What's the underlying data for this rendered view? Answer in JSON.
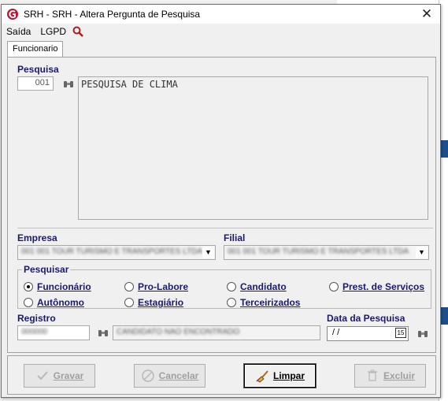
{
  "window": {
    "title": "SRH -  SRH - Altera Pergunta de Pesquisa",
    "close": "✕"
  },
  "menu": {
    "items": [
      "Saída",
      "LGPD"
    ]
  },
  "tabs": [
    {
      "label": "Funcionario"
    }
  ],
  "form": {
    "pesquisa_label": "Pesquisa",
    "pesquisa_code": "001",
    "pesquisa_text": "PESQUISA DE CLIMA",
    "empresa_label": "Empresa",
    "empresa_value": "001 001 TOUR TURISMO E TRANSPORTES LTDA",
    "filial_label": "Filial",
    "filial_value": "001 001 TOUR TURISMO E TRANSPORTES LTDA",
    "pesquisar_label": "Pesquisar",
    "radios": [
      {
        "label": "Funcionário",
        "checked": true
      },
      {
        "label": "Pro-Labore",
        "checked": false
      },
      {
        "label": "Candidato",
        "checked": false
      },
      {
        "label": "Prest. de Serviços",
        "checked": false
      },
      {
        "label": "Autônomo",
        "checked": false
      },
      {
        "label": "Estagiário",
        "checked": false
      },
      {
        "label": "Terceirizados",
        "checked": false
      }
    ],
    "registro_label": "Registro",
    "registro_value": "000000",
    "registro_name": "CANDIDATO NAO ENCONTRADO",
    "data_label": "Data da Pesquisa",
    "data_value": "/  /",
    "cal_day": "15"
  },
  "buttons": {
    "gravar": "Gravar",
    "cancelar": "Cancelar",
    "limpar": "Limpar",
    "excluir": "Excluir"
  },
  "colors": {
    "label_blue": "#1a1a6e",
    "disabled_text": "#a0a0a0",
    "logo_red": "#c8102e"
  }
}
